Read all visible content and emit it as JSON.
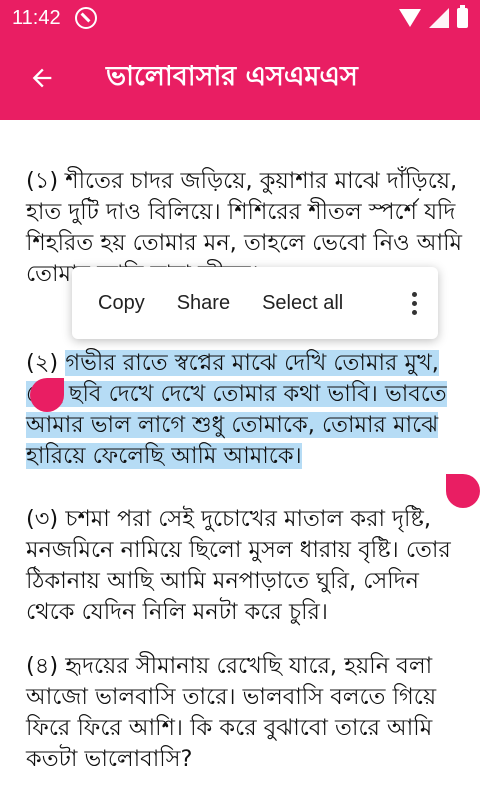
{
  "status_bar": {
    "time": "11:42"
  },
  "app_bar": {
    "title": "ভালোবাসার এসএমএস"
  },
  "messages": [
    "(১) শীতের চাদর জড়িয়ে, কুয়াশার মাঝে দাঁড়িয়ে, হাত দুটি দাও বিলিয়ে। শিশিরের শীতল স্পর্শে যদি শিহরিত হয় তোমার মন, তাহলে ভেবো নিও আমি তোমার আছি সারা জীবন।",
    "(৩) চশমা পরা সেই দুচোখের মাতাল করা দৃষ্টি, মনজমিনে নামিয়ে ছিলো মুসল ধারায় বৃষ্টি। তোর ঠিকানায় আছি আমি মনপাড়াতে ঘুরি, সেদিন থেকে যেদিন নিলি মনটা করে চুরি।",
    "(৪) হৃদয়ের সীমানায় রেখেছি যারে, হয়নি বলা আজো ভালবাসি তারে। ভালবাসি বলতে গিয়ে ফিরে ফিরে আশি। কি করে বুঝাবো তারে আমি কতটা ভালোবাসি?"
  ],
  "selected_message": {
    "prefix": "(২) ",
    "selected_text": "গভীর রাতে স্বপ্নের মাঝে দেখি তোমার মুখ, সেই ছবি দেখে দেখে তোমার কথা ভাবি। ভাবতে আমার ভাল লাগে শুধু তোমাকে, তোমার মাঝে হারিয়ে ফেলেছি আমি আমাকে।"
  },
  "context_menu": {
    "copy": "Copy",
    "share": "Share",
    "select_all": "Select all"
  },
  "colors": {
    "primary": "#e91e63",
    "selection": "#b6dcf5"
  }
}
